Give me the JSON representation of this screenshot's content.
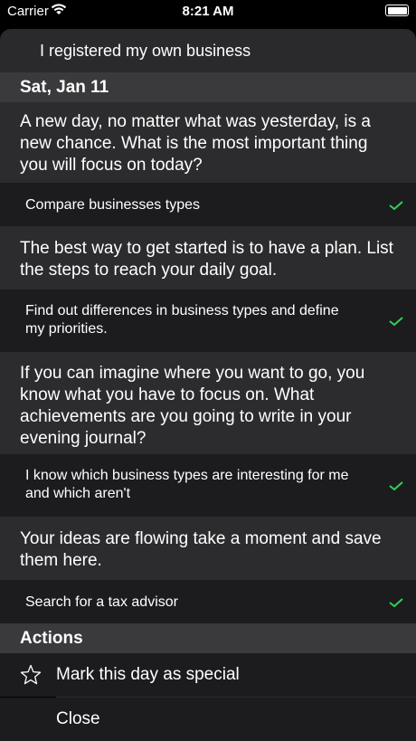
{
  "status": {
    "carrier": "Carrier",
    "time": "8:21 AM"
  },
  "top_entry": "I registered my own business",
  "date_header": "Sat, Jan 11",
  "entries": [
    {
      "question": "A new day, no matter what was yesterday, is a new chance. What is the most important thing you will focus on today?",
      "answer": "Compare businesses types"
    },
    {
      "question": "The best way to get started is to have a plan. List the steps to reach your daily goal.",
      "answer": "Find out differences in business types and define my priorities."
    },
    {
      "question": "If you can imagine where you want to go, you know what you have to focus on. What achievements are you going to write in your evening journal?",
      "answer": "I know which business types are interesting for me and which aren't"
    },
    {
      "question": "Your ideas are flowing take a moment and save them here.",
      "answer": "Search for a tax advisor"
    }
  ],
  "actions_header": "Actions",
  "actions": {
    "special": "Mark this day as special",
    "close": "Close"
  },
  "colors": {
    "check": "#30d158",
    "background": "#000000"
  }
}
